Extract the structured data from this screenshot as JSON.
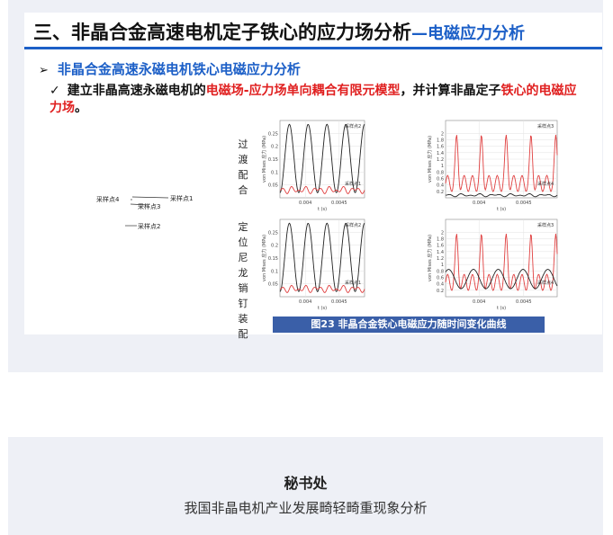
{
  "slide": {
    "title_main": "三、非晶合金高速电机定子铁心的应力场分析",
    "title_sub": "—电磁应力分析",
    "bullet1_mark": "➢",
    "bullet1_text": "非晶合金高速永磁电机铁心电磁应力分析",
    "bullet2_mark": "✓",
    "bullet2_part1": "建立非晶高速永磁电机的",
    "bullet2_red1": "电磁场-应力场单向耦合有限元模型",
    "bullet2_part2": "，并计算非晶定子",
    "bullet2_red2": "铁心的电磁应力场",
    "bullet2_part3": "。",
    "stator_labels": [
      "采样点1",
      "采样点2",
      "采样点3",
      "采样点4"
    ],
    "row1_label": "过渡配合",
    "row2_label": "定位尼龙销钉装配",
    "caption": "图23 非晶合金铁心电磁应力随时间变化曲线"
  },
  "chart_data": [
    {
      "type": "line",
      "id": "top-left",
      "ylabel": "von Mises 应力 (MPa)",
      "xlabel": "t (s)",
      "ylim": [
        0,
        0.3
      ],
      "yticks": [
        0.05,
        0.1,
        0.15,
        0.2,
        0.25
      ],
      "xticks": [
        "0.004",
        "0.0045"
      ],
      "series": [
        {
          "name": "采样点2",
          "color": "#222222",
          "kind": "sine",
          "min": 0.02,
          "max": 0.285,
          "cycles": 4.5
        },
        {
          "name": "采样点1",
          "color": "#e04040",
          "kind": "low",
          "base": 0.03,
          "amp": 0.015,
          "cycles": 4.5
        }
      ]
    },
    {
      "type": "line",
      "id": "top-right",
      "ylabel": "von Mises 应力 (MPa)",
      "xlabel": "t (s)",
      "ylim": [
        0,
        2.4
      ],
      "yticks": [
        0.2,
        0.4,
        0.6,
        0.8,
        1,
        1.2,
        1.4,
        1.6,
        1.8,
        2
      ],
      "xticks": [
        "0.004",
        "0.0045"
      ],
      "series": [
        {
          "name": "采样点3",
          "color": "#e04040",
          "kind": "spiky",
          "base": 0.9,
          "amp": 1.3,
          "cycles": 4.5
        },
        {
          "name": "采样点4",
          "color": "#222222",
          "kind": "low",
          "base": 0.08,
          "amp": 0.05,
          "cycles": 4.5
        }
      ]
    },
    {
      "type": "line",
      "id": "bottom-left",
      "ylabel": "von Mises 应力 (MPa)",
      "xlabel": "t (s)",
      "ylim": [
        0,
        0.3
      ],
      "yticks": [
        0.05,
        0.1,
        0.15,
        0.2,
        0.25
      ],
      "xticks": [
        "0.004",
        "0.0045"
      ],
      "series": [
        {
          "name": "采样点2",
          "color": "#222222",
          "kind": "sine",
          "min": 0.02,
          "max": 0.285,
          "cycles": 4.5
        },
        {
          "name": "采样点1",
          "color": "#e04040",
          "kind": "low",
          "base": 0.03,
          "amp": 0.015,
          "cycles": 4.5
        }
      ]
    },
    {
      "type": "line",
      "id": "bottom-right",
      "ylabel": "von Mises 应力 (MPa)",
      "xlabel": "t (s)",
      "ylim": [
        0,
        2.4
      ],
      "yticks": [
        0.2,
        0.4,
        0.6,
        0.8,
        1,
        1.2,
        1.4,
        1.6,
        1.8,
        2
      ],
      "xticks": [
        "0.004",
        "0.0045"
      ],
      "series": [
        {
          "name": "采样点3",
          "color": "#e04040",
          "kind": "spiky",
          "base": 0.9,
          "amp": 1.3,
          "cycles": 4.5
        },
        {
          "name": "采样点4",
          "color": "#222222",
          "kind": "wavy",
          "base": 0.55,
          "amp": 0.3,
          "cycles": 4.5
        }
      ]
    }
  ],
  "footer": {
    "title": "秘书处",
    "subtitle": "我国非晶电机产业发展畸轻畸重现象分析"
  }
}
